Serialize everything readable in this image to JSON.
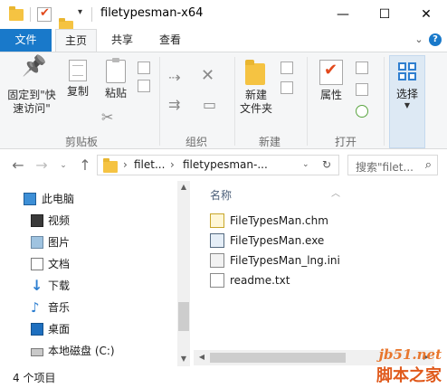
{
  "window": {
    "title": "filetypesman-x64",
    "minimize_glyph": "—",
    "maximize_glyph": "☐",
    "close_glyph": "✕"
  },
  "quick_access": {
    "customize_glyph": "▾"
  },
  "tabs": [
    {
      "label": "文件"
    },
    {
      "label": "主页"
    },
    {
      "label": "共享"
    },
    {
      "label": "查看"
    }
  ],
  "ribbon": {
    "groups": {
      "clipboard": {
        "label": "剪贴板",
        "pin_label_line1": "固定到\"快",
        "pin_label_line2": "速访问\"",
        "copy_label": "复制",
        "paste_label": "粘贴"
      },
      "organize": {
        "label": "组织"
      },
      "new": {
        "label": "新建",
        "new_folder_line1": "新建",
        "new_folder_line2": "文件夹"
      },
      "open": {
        "label": "打开",
        "properties_label": "属性"
      },
      "select": {
        "label": "选择"
      }
    }
  },
  "address": {
    "segment1": "filet...",
    "segment2": "filetypesman-...",
    "search_placeholder": "搜索\"filet..."
  },
  "nav_pane": {
    "items": [
      {
        "label": "此电脑",
        "icon": "computer-icon"
      },
      {
        "label": "视频",
        "icon": "video-icon"
      },
      {
        "label": "图片",
        "icon": "pictures-icon"
      },
      {
        "label": "文档",
        "icon": "documents-icon"
      },
      {
        "label": "下载",
        "icon": "download-icon"
      },
      {
        "label": "音乐",
        "icon": "music-icon"
      },
      {
        "label": "桌面",
        "icon": "desktop-icon"
      },
      {
        "label": "本地磁盘 (C:)",
        "icon": "drive-icon"
      }
    ]
  },
  "file_list": {
    "column_name": "名称",
    "files": [
      {
        "name": "FileTypesMan.chm",
        "icon": "help-file-icon"
      },
      {
        "name": "FileTypesMan.exe",
        "icon": "exe-file-icon"
      },
      {
        "name": "FileTypesMan_lng.ini",
        "icon": "ini-file-icon"
      },
      {
        "name": "readme.txt",
        "icon": "txt-file-icon"
      }
    ]
  },
  "status": {
    "item_count": "4 个项目"
  },
  "watermark": {
    "line1": "jb51.net",
    "line2": "脚本之家"
  },
  "colors": {
    "accent": "#1979ca",
    "folder": "#f5c342"
  }
}
